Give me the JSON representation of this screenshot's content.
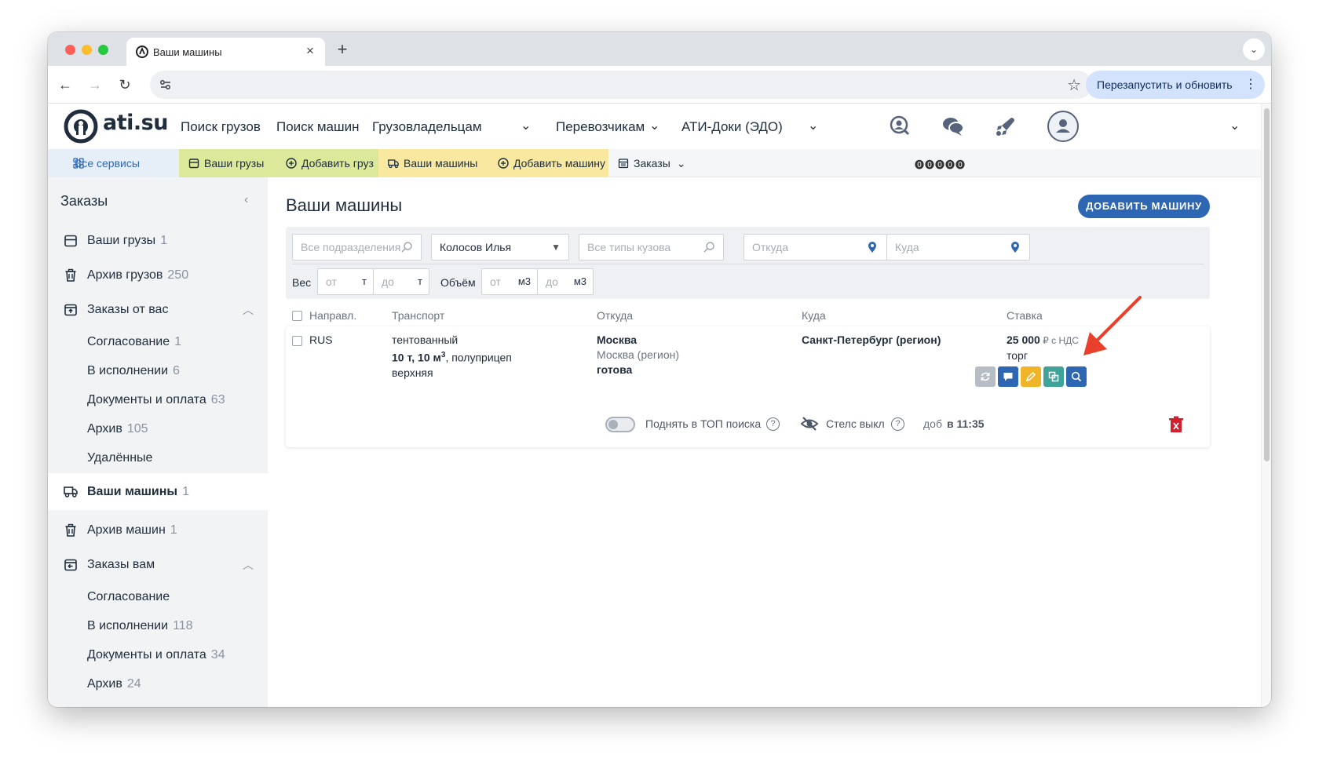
{
  "browser": {
    "tab_title": "Ваши машины",
    "update_button": "Перезапустить и обновить"
  },
  "header": {
    "logo": "ati.su",
    "nav": [
      "Поиск грузов",
      "Поиск машин",
      "Грузовладельцам",
      "Перевозчикам",
      "АТИ-Доки (ЭДО)"
    ]
  },
  "servbar": {
    "all": "Все сервисы",
    "cargo": "Ваши грузы",
    "add_cargo": "Добавить груз",
    "trucks": "Ваши машины",
    "add_truck": "Добавить машину",
    "orders": "Заказы",
    "dots": "⓿⓿⓿⓿⓿"
  },
  "sidebar": {
    "title": "Заказы",
    "items": [
      {
        "label": "Ваши грузы",
        "count": "1"
      },
      {
        "label": "Архив грузов",
        "count": "250"
      },
      {
        "label": "Заказы от вас",
        "count": ""
      },
      {
        "label": "Согласование",
        "count": "1"
      },
      {
        "label": "В исполнении",
        "count": "6"
      },
      {
        "label": "Документы и оплата",
        "count": "63"
      },
      {
        "label": "Архив",
        "count": "105"
      },
      {
        "label": "Удалённые",
        "count": ""
      },
      {
        "label": "Ваши машины",
        "count": "1"
      },
      {
        "label": "Архив машин",
        "count": "1"
      },
      {
        "label": "Заказы вам",
        "count": ""
      },
      {
        "label": "Согласование",
        "count": ""
      },
      {
        "label": "В исполнении",
        "count": "118"
      },
      {
        "label": "Документы и оплата",
        "count": "34"
      },
      {
        "label": "Архив",
        "count": "24"
      }
    ]
  },
  "main": {
    "title": "Ваши машины",
    "add_button": "ДОБАВИТЬ МАШИНУ",
    "filters": {
      "subdivisions_placeholder": "Все подразделения",
      "person": "Колосов Илья",
      "body_types_placeholder": "Все типы кузова",
      "from_placeholder": "Откуда",
      "to_placeholder": "Куда",
      "weight_label": "Вес",
      "weight_from": "от",
      "weight_to": "до",
      "weight_unit": "т",
      "volume_label": "Объём",
      "volume_from": "от",
      "volume_to": "до",
      "volume_unit": "м3"
    },
    "columns": [
      "Направл.",
      "Транспорт",
      "Откуда",
      "Куда",
      "Ставка"
    ],
    "row": {
      "direction": "RUS",
      "transport_type": "тентованный",
      "transport_capacity": "10 т, 10 м",
      "transport_cap_sup": "3",
      "transport_trailer": ", полуприцеп",
      "transport_loading": "верхняя",
      "from_city": "Москва",
      "from_region": "Москва (регион)",
      "from_status": "готова",
      "to_city": "Санкт-Петербург (регион)",
      "rate": "25 000",
      "rate_suffix": " ₽ с НДС",
      "rate_note": "торг",
      "raise_top": "Поднять в ТОП поиска",
      "stealth": "Стелс выкл",
      "added_prefix": "доб",
      "added_time": "в 11:35"
    }
  }
}
